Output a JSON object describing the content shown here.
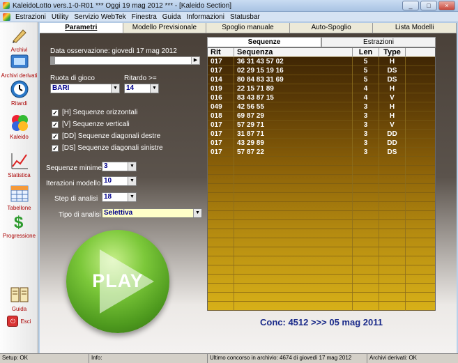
{
  "window": {
    "title": "KaleidoLotto vers.1-0-R01  ***  Oggi 19 mag 2012  ***  - [Kaleido Section]"
  },
  "menu": [
    "Estrazioni",
    "Utility",
    "Servizio WebTek",
    "Finestra",
    "Guida",
    "Informazioni",
    "Statusbar"
  ],
  "sidebar": [
    {
      "label": "Archivi",
      "icon": "pencil-icon"
    },
    {
      "label": "Archivi derivati",
      "icon": "database-icon"
    },
    {
      "label": "Ritardi",
      "icon": "clock-icon"
    },
    {
      "label": "Kaleido",
      "icon": "kaleido-icon"
    },
    {
      "label": "Statistica",
      "icon": "chart-icon"
    },
    {
      "label": "Tabellone",
      "icon": "table-icon"
    },
    {
      "label": "Progressione",
      "icon": "dollar-icon"
    },
    {
      "label": "Guida",
      "icon": "book-icon"
    },
    {
      "label": "Esci",
      "icon": "exit-icon"
    }
  ],
  "tabs": [
    "Parametri",
    "Modello Previsionale",
    "Spoglio manuale",
    "Auto-Spoglio",
    "Lista Modelli"
  ],
  "params": {
    "data_osservazione": "Data osservazione: giovedì 17 mag 2012",
    "ruota_label": "Ruota di gioco",
    "ruota_value": "BARI",
    "ritardo_label": "Ritardo >=",
    "ritardo_value": "14",
    "checks": [
      {
        "label": "[H] Sequenze orizzontali",
        "checked": true
      },
      {
        "label": "[V] Sequenze verticali",
        "checked": true
      },
      {
        "label": "[DD] Sequenze diagonali destre",
        "checked": true
      },
      {
        "label": "[DS] Sequenze diagonali sinistre",
        "checked": true
      }
    ],
    "seq_min_label": "Sequenze minime",
    "seq_min_value": "3",
    "iter_label": "Iterazioni modello",
    "iter_value": "10",
    "step_label": "Step di analisi",
    "step_value": "18",
    "tipo_label": "Tipo di analisi",
    "tipo_value": "Selettiva",
    "play_label": "PLAY"
  },
  "results": {
    "tabs": [
      "Sequenze",
      "Estrazioni"
    ],
    "columns": [
      "Rit",
      "Sequenza",
      "Len",
      "Type"
    ],
    "rows": [
      [
        "017",
        "36 31 43 57 02",
        "5",
        "H"
      ],
      [
        "017",
        "02 29 15 19 16",
        "5",
        "DS"
      ],
      [
        "014",
        "80 84 83 31 69",
        "5",
        "DS"
      ],
      [
        "019",
        "22 15 71 89",
        "4",
        "H"
      ],
      [
        "016",
        "83 43 87 15",
        "4",
        "V"
      ],
      [
        "049",
        "42 56 55",
        "3",
        "H"
      ],
      [
        "018",
        "69 87 29",
        "3",
        "H"
      ],
      [
        "017",
        "57 29 71",
        "3",
        "V"
      ],
      [
        "017",
        "31 87 71",
        "3",
        "DD"
      ],
      [
        "017",
        "43 29 89",
        "3",
        "DD"
      ],
      [
        "017",
        "57 87 22",
        "3",
        "DS"
      ]
    ],
    "conc": "Conc: 4512 >>> 05 mag 2011"
  },
  "status": {
    "setup": "Setup: OK",
    "info": "Info:",
    "ultimo": "Ultimo concorso in archivio: 4674 di giovedì 17 mag 2012",
    "archivi": "Archivi derivati: OK"
  }
}
